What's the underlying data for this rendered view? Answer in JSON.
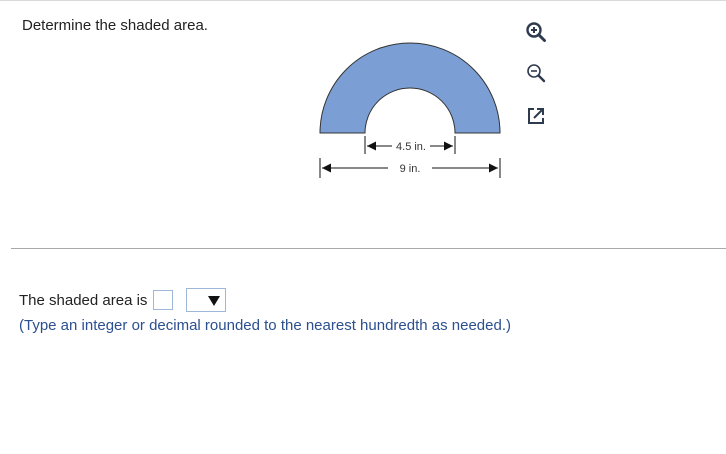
{
  "question": {
    "prompt": "Determine the shaded area."
  },
  "figure": {
    "inner_diameter_label": "4.5 in.",
    "outer_diameter_label": "9 in.",
    "shape": "half annulus",
    "fill_color": "#7b9fd4",
    "stroke_color": "#333333"
  },
  "toolbar": {
    "zoom_in": "zoom-in-icon",
    "zoom_out": "zoom-out-icon",
    "popout": "popout-icon"
  },
  "answer": {
    "prefix": "The shaded area is",
    "input_value": "",
    "unit_selected": "",
    "hint": "(Type an integer or decimal rounded to the nearest hundredth as needed.)"
  },
  "colors": {
    "accent": "#2b4f8f",
    "input_border": "#9fb7d6",
    "divider": "#a9a9a9"
  }
}
